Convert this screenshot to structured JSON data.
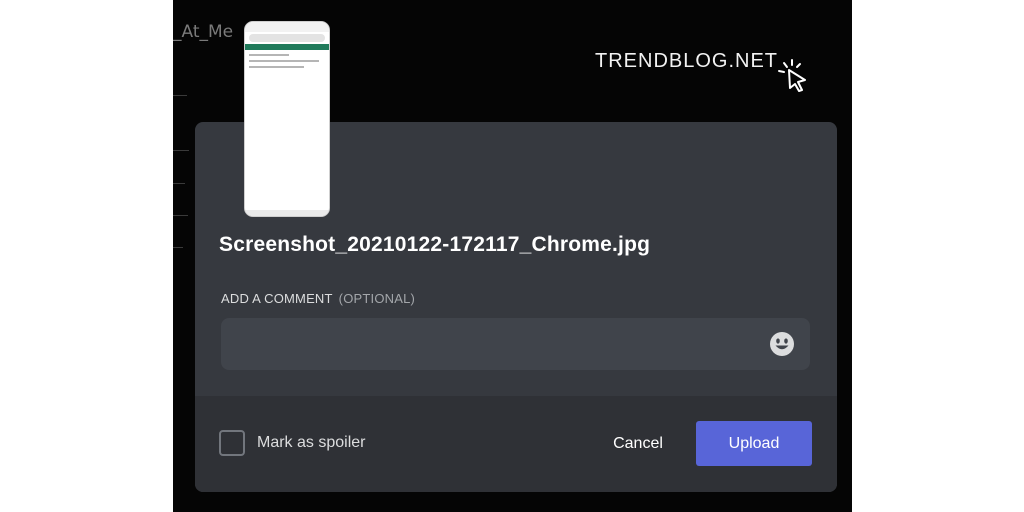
{
  "background": {
    "channel_text": "_At_Me"
  },
  "watermark": {
    "text": "TRENDBLOG.NET"
  },
  "dialog": {
    "filename": "Screenshot_20210122-172117_Chrome.jpg",
    "comment_label": "ADD A COMMENT",
    "comment_optional": "(OPTIONAL)",
    "comment_value": "",
    "spoiler_label": "Mark as spoiler",
    "cancel_label": "Cancel",
    "upload_label": "Upload"
  },
  "icons": {
    "emoji": "smile-emoji-icon",
    "cursor": "click-cursor-icon"
  },
  "colors": {
    "modal_bg": "#36393f",
    "footer_bg": "#2f3136",
    "input_bg": "#40444b",
    "upload_button": "#5865d8"
  }
}
